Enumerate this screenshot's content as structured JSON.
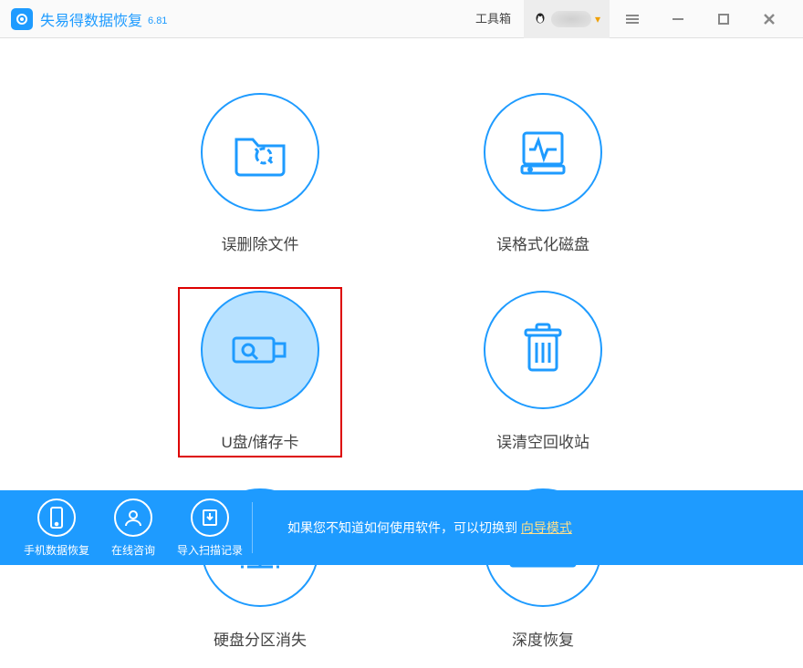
{
  "app": {
    "title": "失易得数据恢复",
    "version": "6.81"
  },
  "titlebar": {
    "toolbox_label": "工具箱"
  },
  "options": [
    {
      "id": "deleted-files",
      "label": "误删除文件",
      "selected": false
    },
    {
      "id": "formatted-disk",
      "label": "误格式化磁盘",
      "selected": false
    },
    {
      "id": "usb-card",
      "label": "U盘/储存卡",
      "selected": true
    },
    {
      "id": "emptied-recycle",
      "label": "误清空回收站",
      "selected": false
    },
    {
      "id": "lost-partition",
      "label": "硬盘分区消失",
      "selected": false
    },
    {
      "id": "deep-recover",
      "label": "深度恢复",
      "selected": false
    }
  ],
  "footer": {
    "buttons": [
      {
        "id": "mobile-recover",
        "label": "手机数据恢复"
      },
      {
        "id": "online-consult",
        "label": "在线咨询"
      },
      {
        "id": "import-scan",
        "label": "导入扫描记录"
      }
    ],
    "hint_text": "如果您不知道如何使用软件，可以切换到 ",
    "hint_link": "向导模式"
  },
  "colors": {
    "accent": "#1e9bff",
    "highlight_border": "#d00000"
  }
}
